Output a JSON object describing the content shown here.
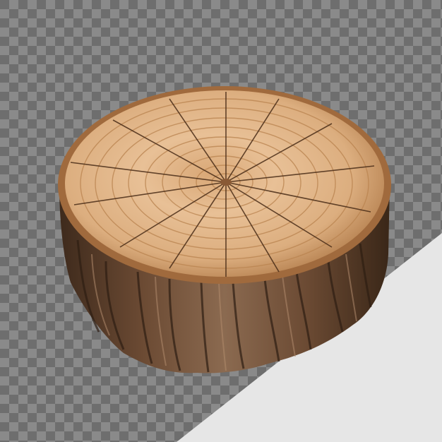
{
  "image": {
    "subject": "tree-stump",
    "background": "transparent-checkerboard",
    "colors": {
      "checker_dark": "#6e6e6e",
      "checker_light": "#8a8a8a",
      "wedge": "#e6e6e6",
      "wood_light": "#e3b78a",
      "wood_mid": "#c98f5c",
      "wood_dark": "#8a5a35",
      "bark_dark": "#3e2a1c",
      "bark_mid": "#6b4a33",
      "bark_light": "#9a7558"
    }
  }
}
